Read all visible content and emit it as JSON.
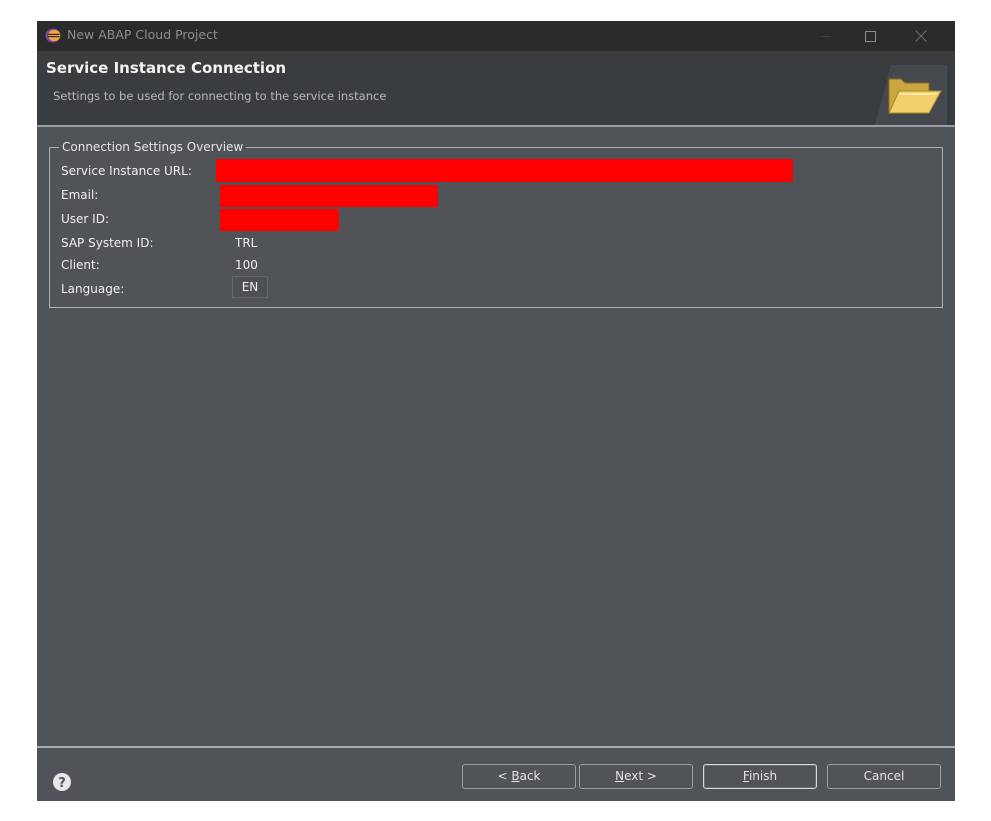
{
  "window": {
    "title": "New ABAP Cloud Project"
  },
  "header": {
    "title": "Service Instance Connection",
    "subtitle": "Settings to be used for connecting to the service instance"
  },
  "group": {
    "legend": "Connection Settings Overview",
    "rows": [
      {
        "label": "Service Instance URL:",
        "value": "",
        "redacted": true
      },
      {
        "label": "Email:",
        "value": "",
        "redacted": true
      },
      {
        "label": "User ID:",
        "value": "",
        "redacted": true
      },
      {
        "label": "SAP System ID:",
        "value": "TRL",
        "redacted": false
      },
      {
        "label": "Client:",
        "value": "100",
        "redacted": false
      },
      {
        "label": "Language:",
        "value": "EN",
        "redacted": false
      }
    ]
  },
  "footer": {
    "back_label": "< Back",
    "back_mnemonic": "B",
    "next_label": "Next >",
    "next_mnemonic": "N",
    "finish_label": "Finish",
    "finish_mnemonic": "F",
    "cancel_label": "Cancel"
  },
  "colors": {
    "redaction": "#ff0000",
    "window_background": "#505357",
    "header_background": "#3a3d40",
    "titlebar_background": "#2b2b2b"
  },
  "icons": {
    "app": "eclipse-icon",
    "header": "open-folder-icon",
    "help": "help-icon",
    "minimize": "minimize-icon",
    "maximize": "maximize-icon",
    "close": "close-icon"
  }
}
